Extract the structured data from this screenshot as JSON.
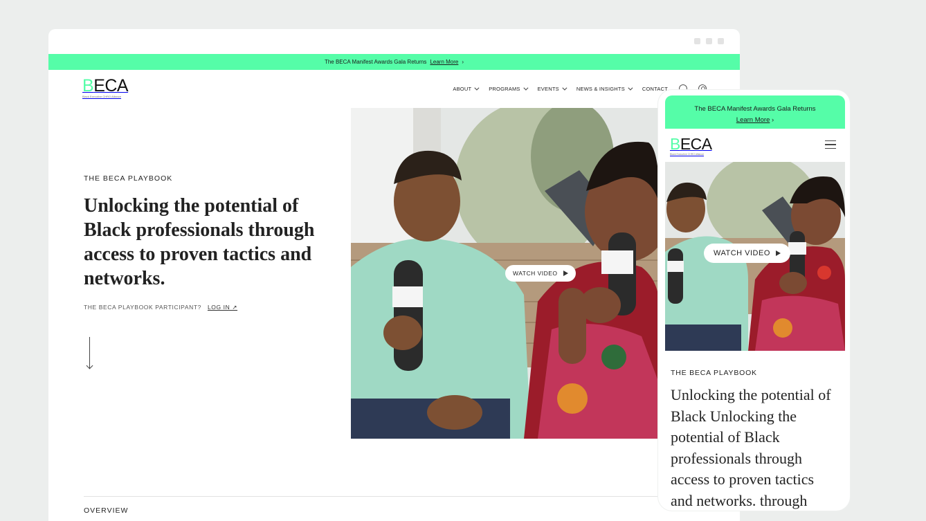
{
  "desktop": {
    "announcement": {
      "text": "The BECA Manifest Awards Gala Returns",
      "link": "Learn More",
      "link_arrow": "›"
    },
    "logo": {
      "mark_first": "B",
      "mark_rest": "ECA",
      "tagline": "Black Executive CHRO Alliance"
    },
    "nav": {
      "items": [
        {
          "label": "ABOUT",
          "has_dropdown": true
        },
        {
          "label": "PROGRAMS",
          "has_dropdown": true
        },
        {
          "label": "EVENTS",
          "has_dropdown": true
        },
        {
          "label": "NEWS & INSIGHTS",
          "has_dropdown": true
        },
        {
          "label": "CONTACT",
          "has_dropdown": false
        }
      ],
      "icons": [
        "search-icon",
        "user-icon"
      ]
    },
    "hero": {
      "eyebrow": "THE BECA PLAYBOOK",
      "headline": "Unlocking the potential of Black professionals through access to proven tactics and networks.",
      "participant_text": "THE BECA PLAYBOOK PARTICIPANT?",
      "login_label": "LOG IN ↗",
      "watch_label": "WATCH VIDEO"
    },
    "section": {
      "overview": "OVERVIEW"
    }
  },
  "mobile": {
    "announcement": {
      "text": "The BECA Manifest Awards Gala Returns",
      "link": "Learn More",
      "link_arrow": "›"
    },
    "logo": {
      "mark_first": "B",
      "mark_rest": "ECA",
      "tagline": "Black Executive CHRO Alliance"
    },
    "hero": {
      "watch_label": "WATCH VIDEO",
      "eyebrow": "THE BECA PLAYBOOK",
      "headline": "Unlocking the potential of Black Unlocking the potential of Black professionals through access to proven tactics and networks. through"
    }
  },
  "colors": {
    "accent_green": "#55fda8",
    "text_dark": "#222222",
    "shirt_teal": "#9fd9c4"
  }
}
